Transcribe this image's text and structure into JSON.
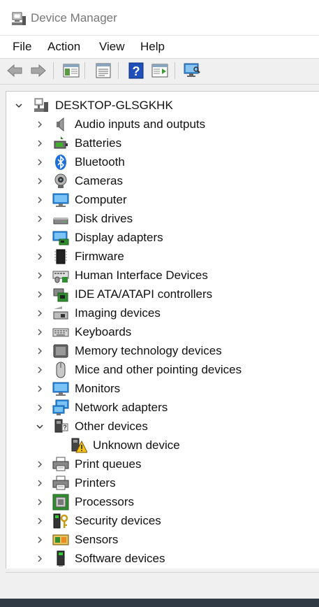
{
  "window": {
    "title": "Device Manager"
  },
  "menu": [
    "File",
    "Action",
    "View",
    "Help"
  ],
  "tree": {
    "root": "DESKTOP-GLSGKHK",
    "categories": [
      "Audio inputs and outputs",
      "Batteries",
      "Bluetooth",
      "Cameras",
      "Computer",
      "Disk drives",
      "Display adapters",
      "Firmware",
      "Human Interface Devices",
      "IDE ATA/ATAPI controllers",
      "Imaging devices",
      "Keyboards",
      "Memory technology devices",
      "Mice and other pointing devices",
      "Monitors",
      "Network adapters",
      "Other devices",
      "Unknown device",
      "Print queues",
      "Printers",
      "Processors",
      "Security devices",
      "Sensors",
      "Software devices"
    ]
  },
  "icons": {
    "chevron": "chevron-right-icon",
    "expanded": "chevron-down-icon"
  }
}
